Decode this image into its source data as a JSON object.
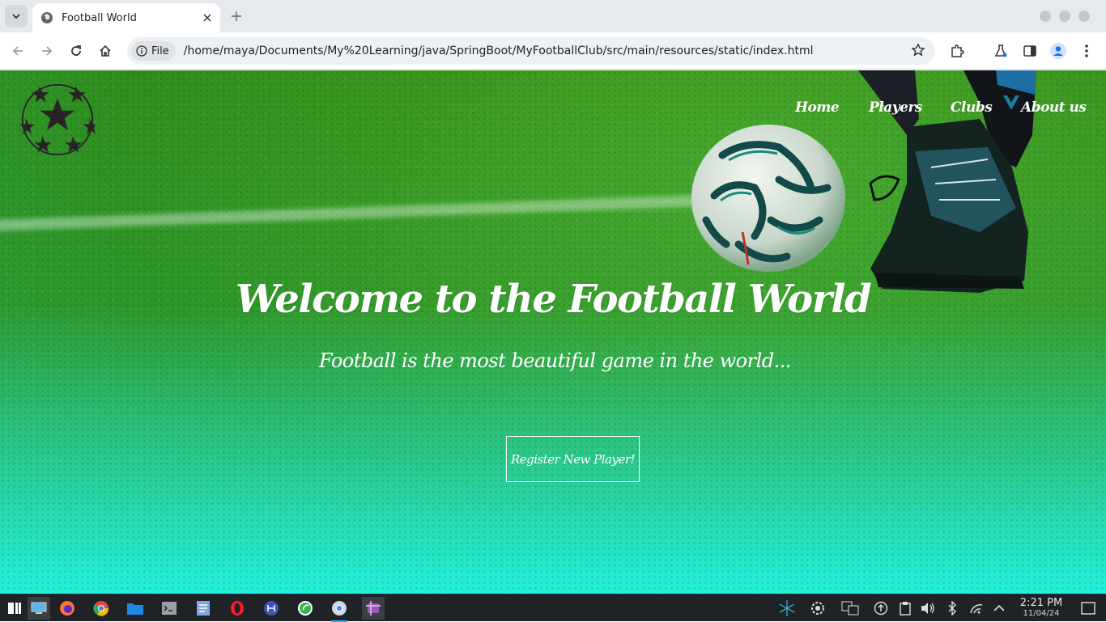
{
  "browser": {
    "tab_title": "Football World",
    "address_chip": "File",
    "url": "/home/maya/Documents/My%20Learning/java/SpringBoot/MyFootballClub/src/main/resources/static/index.html"
  },
  "page": {
    "nav": {
      "home": "Home",
      "players": "Players",
      "clubs": "Clubs",
      "about": "About us"
    },
    "hero": {
      "title": "Welcome to the Football World",
      "subtitle": "Football is the most beautiful game in the world...",
      "cta": "Register New Player!"
    },
    "colors": {
      "grass_top": "#3b961f",
      "gradient_bottom": "#22f0dc",
      "text": "#ffffff"
    }
  },
  "taskbar": {
    "time": "2:21 PM",
    "date": "11/04/24",
    "apps": [
      "start-menu-icon",
      "desktop-icon",
      "firefox-icon",
      "chrome-icon",
      "files-icon",
      "terminal-icon",
      "notes-icon",
      "opera-icon",
      "app-icon",
      "green-app-icon",
      "chromium-icon",
      "screenshot-icon"
    ]
  }
}
